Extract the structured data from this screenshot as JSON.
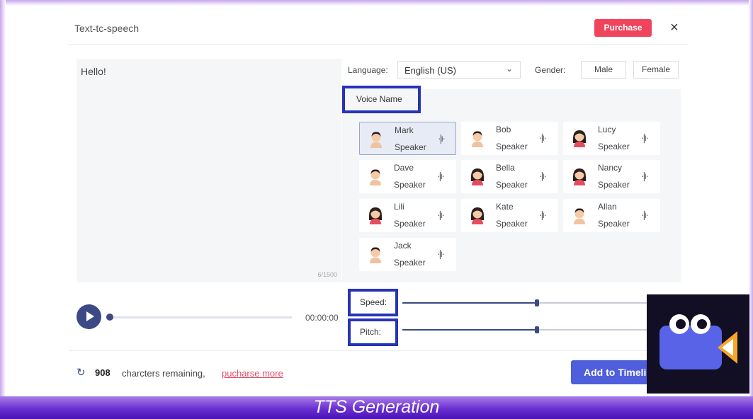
{
  "dialog": {
    "title": "Text-tc-speech",
    "purchase_label": "Purchase",
    "close_label": "×"
  },
  "editor": {
    "text": "Hello!",
    "char_count": "6/1500"
  },
  "language": {
    "label": "Language:",
    "value": "English (US)",
    "chevron": "⌄"
  },
  "gender": {
    "label": "Gender:",
    "options": [
      "Male",
      "Female"
    ]
  },
  "voices": {
    "header": "Voice Name",
    "wave_icon": "·|ı·",
    "items": [
      {
        "name": "Mark",
        "role": "Speaker",
        "gender": "male",
        "selected": true
      },
      {
        "name": "Bob",
        "role": "Speaker",
        "gender": "male",
        "selected": false
      },
      {
        "name": "Lucy",
        "role": "Speaker",
        "gender": "female",
        "selected": false
      },
      {
        "name": "Dave",
        "role": "Speaker",
        "gender": "male",
        "selected": false
      },
      {
        "name": "Bella",
        "role": "Speaker",
        "gender": "female",
        "selected": false
      },
      {
        "name": "Nancy",
        "role": "Speaker",
        "gender": "female",
        "selected": false
      },
      {
        "name": "Lili",
        "role": "Speaker",
        "gender": "female",
        "selected": false
      },
      {
        "name": "Kate",
        "role": "Speaker",
        "gender": "female",
        "selected": false
      },
      {
        "name": "Allan",
        "role": "Speaker",
        "gender": "male",
        "selected": false
      },
      {
        "name": "Jack",
        "role": "Speaker",
        "gender": "male",
        "selected": false
      }
    ]
  },
  "player": {
    "time": "00:00:00",
    "progress": 0
  },
  "adjust": {
    "speed_label": "Speed:",
    "pitch_label": "Pitch:",
    "speed_level": 0.5,
    "pitch_level": 0.5
  },
  "footer": {
    "refresh_icon": "↻",
    "remaining_count": "908",
    "remaining_text": "charcters remaining,",
    "link_text": "pucharse more",
    "add_button": "Add to Timeline"
  },
  "caption": "TTS Generation",
  "colors": {
    "accent": "#2733b8",
    "purchase": "#f0445c",
    "add_button": "#4f5edb",
    "caption_bar": "#6a2fd0"
  }
}
